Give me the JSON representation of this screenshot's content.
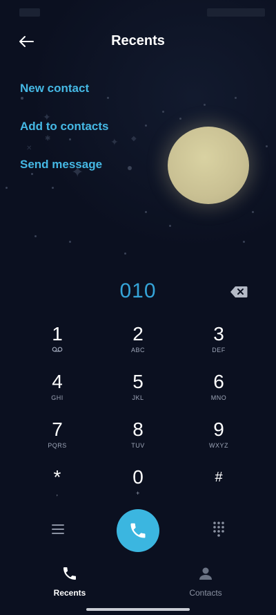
{
  "header": {
    "title": "Recents"
  },
  "actions": [
    {
      "label": "New contact"
    },
    {
      "label": "Add to contacts"
    },
    {
      "label": "Send message"
    }
  ],
  "dialer": {
    "number": "010"
  },
  "keypad": [
    {
      "digit": "1",
      "letters": ""
    },
    {
      "digit": "2",
      "letters": "ABC"
    },
    {
      "digit": "3",
      "letters": "DEF"
    },
    {
      "digit": "4",
      "letters": "GHI"
    },
    {
      "digit": "5",
      "letters": "JKL"
    },
    {
      "digit": "6",
      "letters": "MNO"
    },
    {
      "digit": "7",
      "letters": "PQRS"
    },
    {
      "digit": "8",
      "letters": "TUV"
    },
    {
      "digit": "9",
      "letters": "WXYZ"
    },
    {
      "digit": "*",
      "letters": ","
    },
    {
      "digit": "0",
      "letters": "+"
    },
    {
      "digit": "#",
      "letters": ""
    }
  ],
  "bottom_nav": [
    {
      "label": "Recents",
      "icon": "phone-icon",
      "active": true
    },
    {
      "label": "Contacts",
      "icon": "person-icon",
      "active": false
    }
  ],
  "colors": {
    "accent": "#45b8e4",
    "call_button": "#3bb6e0",
    "background": "#0b1020"
  }
}
